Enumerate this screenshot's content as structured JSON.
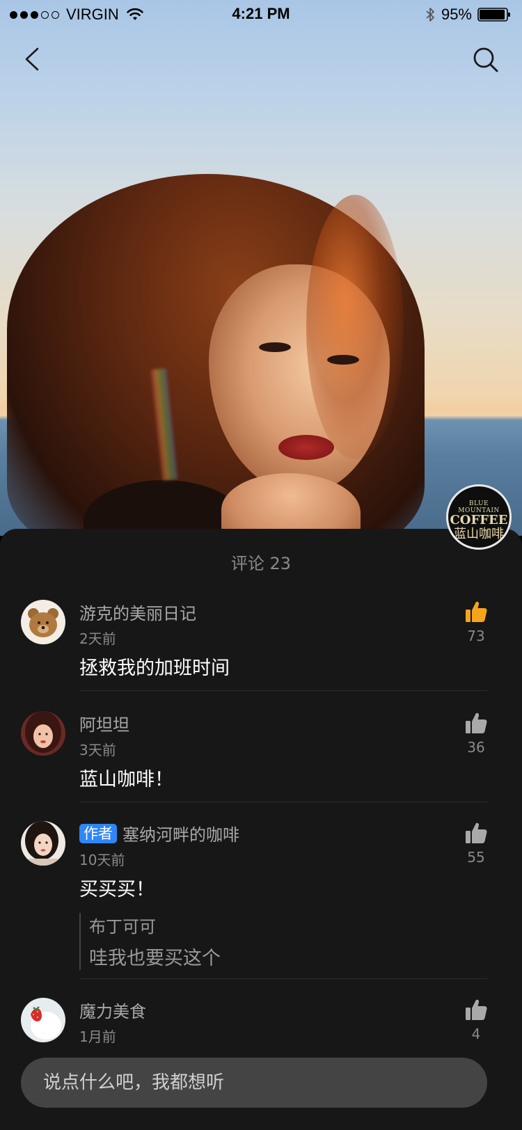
{
  "status_bar": {
    "carrier": "VIRGIN",
    "time": "4:21 PM",
    "battery": "95%",
    "signal_bars": 3,
    "signal_total": 5,
    "battery_level": 0.95
  },
  "brand_badge": {
    "top": "BLUE MOUNTAIN",
    "mid": "COFFEE",
    "cn": "蓝山咖啡"
  },
  "comments_sheet": {
    "title": "评论 23",
    "comments": [
      {
        "name": "游克的美丽日记",
        "time": "2天前",
        "text": "拯救我的加班时间",
        "likes": "73",
        "liked": true
      },
      {
        "name": "阿坦坦",
        "time": "3天前",
        "text": "蓝山咖啡！",
        "likes": "36",
        "liked": false
      },
      {
        "badge": "作者",
        "name": "塞纳河畔的咖啡",
        "time": "10天前",
        "text": "买买买！",
        "likes": "55",
        "liked": false,
        "reply": {
          "name": "布丁可可",
          "text": "哇我也要买这个"
        }
      },
      {
        "name": "魔力美食",
        "time": "1月前",
        "likes": "4",
        "liked": false
      }
    ]
  },
  "input": {
    "placeholder": "说点什么吧，我都想听"
  },
  "colors": {
    "liked": "#f5a41d",
    "unliked": "#a9a9a9",
    "author_badge": "#2f86f6",
    "sheet_bg": "#171717"
  },
  "icons": {
    "back": "chevron-left-icon",
    "search": "search-icon",
    "like": "thumbs-up-icon",
    "wifi": "wifi-icon",
    "bluetooth": "bluetooth-icon",
    "battery": "battery-icon"
  }
}
